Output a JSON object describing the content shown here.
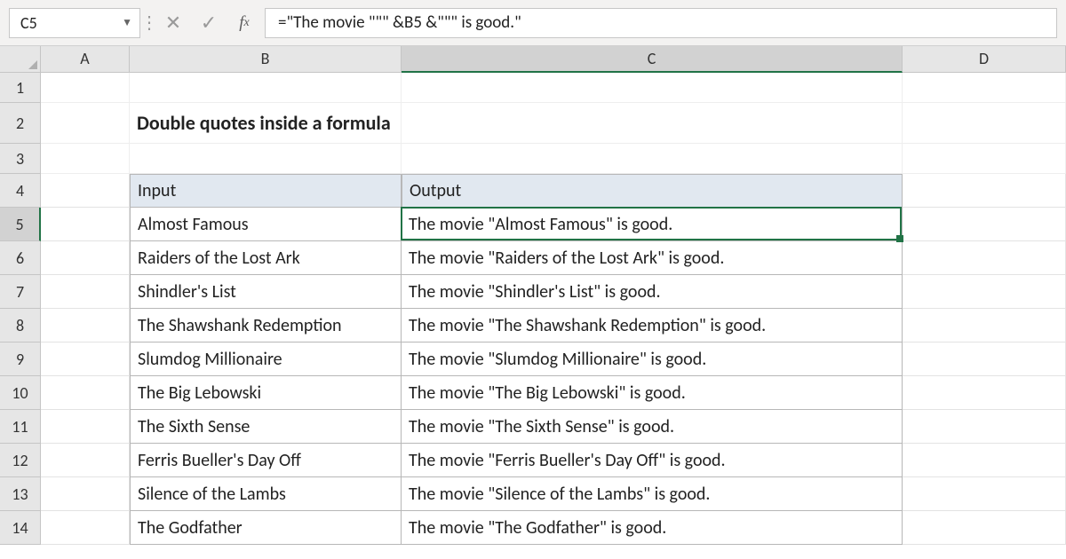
{
  "name_box": "C5",
  "formula": "=\"The movie \"\"\" &B5 &\"\"\" is good.\"",
  "columns": [
    "A",
    "B",
    "C",
    "D"
  ],
  "selected_col": "C",
  "selected_row": 5,
  "title": "Double quotes inside a formula",
  "table_headers": {
    "input": "Input",
    "output": "Output"
  },
  "rows": [
    {
      "n": 5,
      "input": "Almost Famous",
      "output": "The movie \"Almost Famous\" is good."
    },
    {
      "n": 6,
      "input": "Raiders of the Lost Ark",
      "output": "The movie \"Raiders of the Lost Ark\" is good."
    },
    {
      "n": 7,
      "input": "Shindler's List",
      "output": "The movie \"Shindler's List\" is good."
    },
    {
      "n": 8,
      "input": "The Shawshank Redemption",
      "output": "The movie \"The Shawshank Redemption\" is good."
    },
    {
      "n": 9,
      "input": "Slumdog Millionaire",
      "output": "The movie \"Slumdog Millionaire\" is good."
    },
    {
      "n": 10,
      "input": "The Big Lebowski",
      "output": "The movie \"The Big Lebowski\" is good."
    },
    {
      "n": 11,
      "input": "The Sixth Sense",
      "output": "The movie \"The Sixth Sense\" is good."
    },
    {
      "n": 12,
      "input": "Ferris Bueller's Day Off",
      "output": "The movie \"Ferris Bueller's Day Off\" is good."
    },
    {
      "n": 13,
      "input": "Silence of the Lambs",
      "output": "The movie \"Silence of the Lambs\" is good."
    },
    {
      "n": 14,
      "input": "The Godfather",
      "output": "The movie \"The Godfather\" is good."
    }
  ],
  "row_heights": {
    "r1": 34,
    "r2": 46,
    "r3": 34,
    "r4": 38,
    "data": 38
  }
}
